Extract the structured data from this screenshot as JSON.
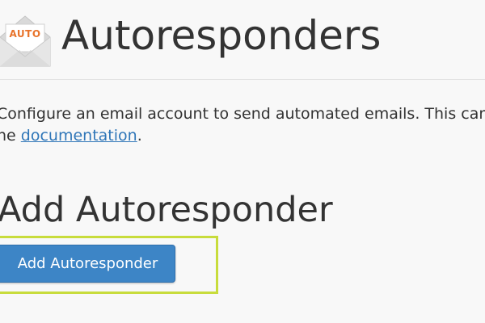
{
  "header": {
    "title": "Autoresponders",
    "icon": {
      "name": "autoresponder-envelope-icon",
      "label": "AUTO",
      "label_color": "#e8732a"
    }
  },
  "description": {
    "text_before": "Configure an email account to send automated emails. This can",
    "line2_before": "he ",
    "link_text": "documentation",
    "text_after": ".",
    "link_color": "#2f76b8"
  },
  "section": {
    "title": "Add Autoresponder",
    "button_label": "Add Autoresponder",
    "button_color": "#3d85c6",
    "highlight_color": "#c8dc3c"
  }
}
